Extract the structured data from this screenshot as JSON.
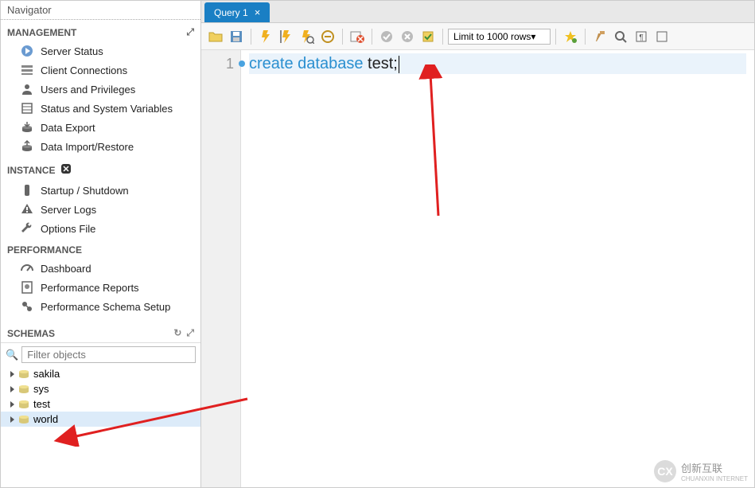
{
  "sidebar": {
    "title": "Navigator",
    "sections": {
      "management": {
        "label": "MANAGEMENT",
        "items": [
          {
            "label": "Server Status"
          },
          {
            "label": "Client Connections"
          },
          {
            "label": "Users and Privileges"
          },
          {
            "label": "Status and System Variables"
          },
          {
            "label": "Data Export"
          },
          {
            "label": "Data Import/Restore"
          }
        ]
      },
      "instance": {
        "label": "INSTANCE",
        "items": [
          {
            "label": "Startup / Shutdown"
          },
          {
            "label": "Server Logs"
          },
          {
            "label": "Options File"
          }
        ]
      },
      "performance": {
        "label": "PERFORMANCE",
        "items": [
          {
            "label": "Dashboard"
          },
          {
            "label": "Performance Reports"
          },
          {
            "label": "Performance Schema Setup"
          }
        ]
      }
    },
    "schemas": {
      "label": "SCHEMAS",
      "filter_placeholder": "Filter objects",
      "items": [
        {
          "name": "sakila"
        },
        {
          "name": "sys"
        },
        {
          "name": "test"
        },
        {
          "name": "world"
        }
      ]
    }
  },
  "tab": {
    "label": "Query 1"
  },
  "toolbar": {
    "limit_label": "Limit to 1000 rows"
  },
  "editor": {
    "line_no": "1",
    "code": {
      "kw1": "create",
      "kw2": "database",
      "ident": "test;"
    }
  },
  "watermark": {
    "badge": "CX",
    "text": "创新互联",
    "sub": "CHUANXIN INTERNET"
  }
}
